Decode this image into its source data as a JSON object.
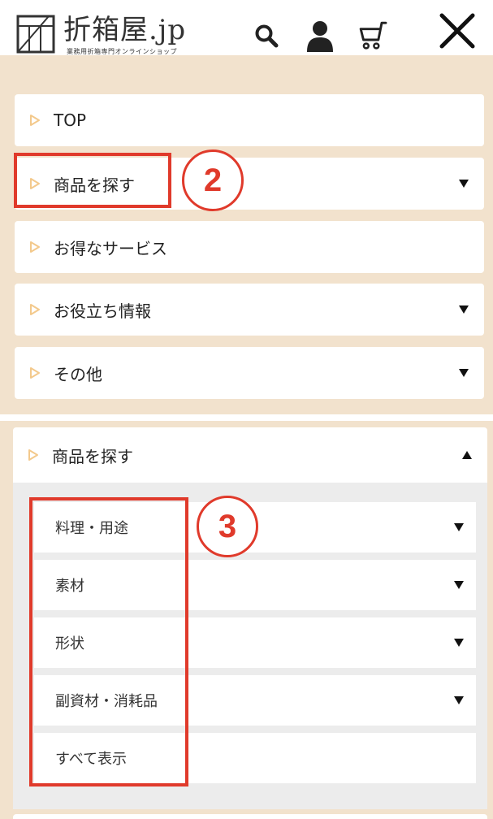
{
  "header": {
    "logo_text": "折箱屋.jp",
    "logo_subtitle": "業務用折箱専門オンラインショップ",
    "icons": [
      "search-icon",
      "user-icon",
      "cart-icon",
      "close-icon"
    ]
  },
  "menu": {
    "items": [
      {
        "label": "TOP",
        "has_caret": false
      },
      {
        "label": "商品を探す",
        "has_caret": true
      },
      {
        "label": "お得なサービス",
        "has_caret": false
      },
      {
        "label": "お役立ち情報",
        "has_caret": true
      },
      {
        "label": "その他",
        "has_caret": true
      }
    ]
  },
  "submenu": {
    "title": "商品を探す",
    "expanded": true,
    "items": [
      {
        "label": "料理・用途",
        "has_caret": true
      },
      {
        "label": "素材",
        "has_caret": true
      },
      {
        "label": "形状",
        "has_caret": true
      },
      {
        "label": "副資材・消耗品",
        "has_caret": true
      },
      {
        "label": "すべて表示",
        "has_caret": false
      }
    ]
  },
  "annotations": {
    "step2": "2",
    "step3": "3"
  },
  "colors": {
    "panel_bg": "#f2e2cd",
    "submenu_bg": "#ececec",
    "triangle_icon": "#f3c98c",
    "annotation_red": "#e03a2b"
  }
}
